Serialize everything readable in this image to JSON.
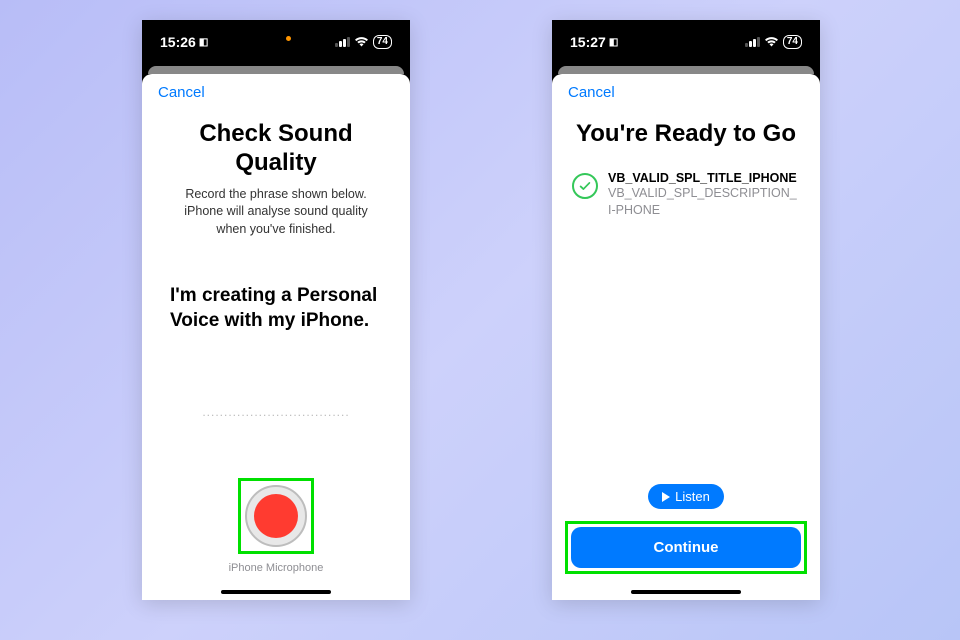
{
  "colors": {
    "accent": "#007aff",
    "highlight": "#00e000",
    "record": "#ff3b30",
    "success": "#34c759"
  },
  "left": {
    "status": {
      "time": "15:26",
      "battery": "74"
    },
    "cancel": "Cancel",
    "title": "Check Sound Quality",
    "subtitle": "Record the phrase shown below. iPhone will analyse sound quality when you've finished.",
    "phrase": "I'm creating a Personal Voice with my iPhone.",
    "dots": "..................................",
    "mic_label": "iPhone Microphone"
  },
  "right": {
    "status": {
      "time": "15:27",
      "battery": "74"
    },
    "cancel": "Cancel",
    "title": "You're Ready to Go",
    "validation": {
      "title": "VB_VALID_SPL_TITLE_IPHONE",
      "description": "VB_VALID_SPL_DESCRIPTION_I-PHONE"
    },
    "listen_label": "Listen",
    "continue_label": "Continue"
  }
}
